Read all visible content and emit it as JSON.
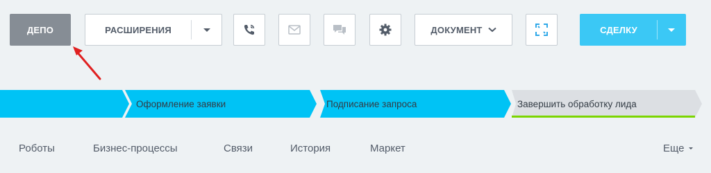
{
  "toolbar": {
    "depo_label": "ДЕПО",
    "extensions_label": "РАСШИРЕНИЯ",
    "document_label": "ДОКУМЕНТ",
    "deal_label": "СДЕЛКУ",
    "icons": [
      "phone-icon",
      "mail-icon",
      "chat-icon",
      "gear-icon",
      "chevron-down-icon",
      "convert-icon"
    ]
  },
  "stages": [
    {
      "label": "",
      "color": "#00c3f5"
    },
    {
      "label": "Оформление заявки",
      "color": "#00c3f5"
    },
    {
      "label": "Подписание запроса",
      "color": "#00c3f5"
    },
    {
      "label": "Завершить обработку лида",
      "color": "#dcdfe3",
      "underline": "#7bd500"
    }
  ],
  "tabs": {
    "items": [
      "Роботы",
      "Бизнес-процессы",
      "Связи",
      "История",
      "Маркет"
    ],
    "more_label": "Еще"
  },
  "colors": {
    "accent": "#3bc8f5",
    "stage_active": "#00c3f5",
    "annotation_arrow": "#e02020",
    "depo_button": "#868d95"
  }
}
